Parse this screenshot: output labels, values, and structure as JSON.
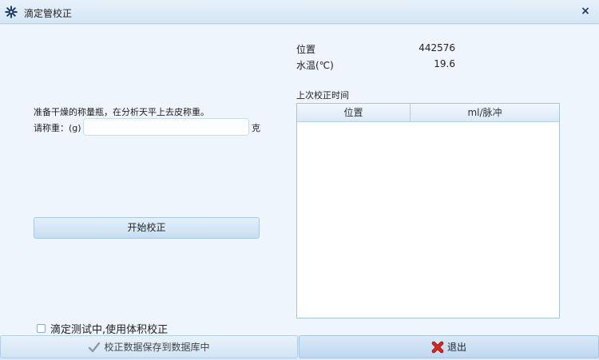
{
  "window": {
    "title": "滴定管校正",
    "title_icon": "gear-icon",
    "close_icon": "close-icon",
    "close_symbol": "×"
  },
  "left_panel": {
    "instruction": "准备干燥的称量瓶，在分析天平上去皮称重。",
    "weigh_label": "请称重：(g)",
    "weigh_value": "",
    "weigh_unit": "克",
    "start_button": "开始校正",
    "volume_checkbox_label": "滴定测试中,使用体积校正",
    "volume_checkbox_checked": false
  },
  "right_panel": {
    "position_label": "位置",
    "position_value": "442576",
    "water_temp_label": "水温(℃)",
    "water_temp_value": "19.6",
    "last_calibration_label": "上次校正时间",
    "table": {
      "columns": [
        "位置",
        "ml/脉冲"
      ],
      "rows": []
    }
  },
  "footer": {
    "save_button": "校正数据保存到数据库中",
    "save_icon": "checkmark-icon",
    "exit_button": "退出",
    "exit_icon": "red-x-icon"
  },
  "colors": {
    "background": "#eef5fc",
    "titlebar": "#dceaf6",
    "accent_border": "#a9c4de",
    "exit_icon": "#d9261c",
    "save_icon": "#8a9aa8"
  }
}
